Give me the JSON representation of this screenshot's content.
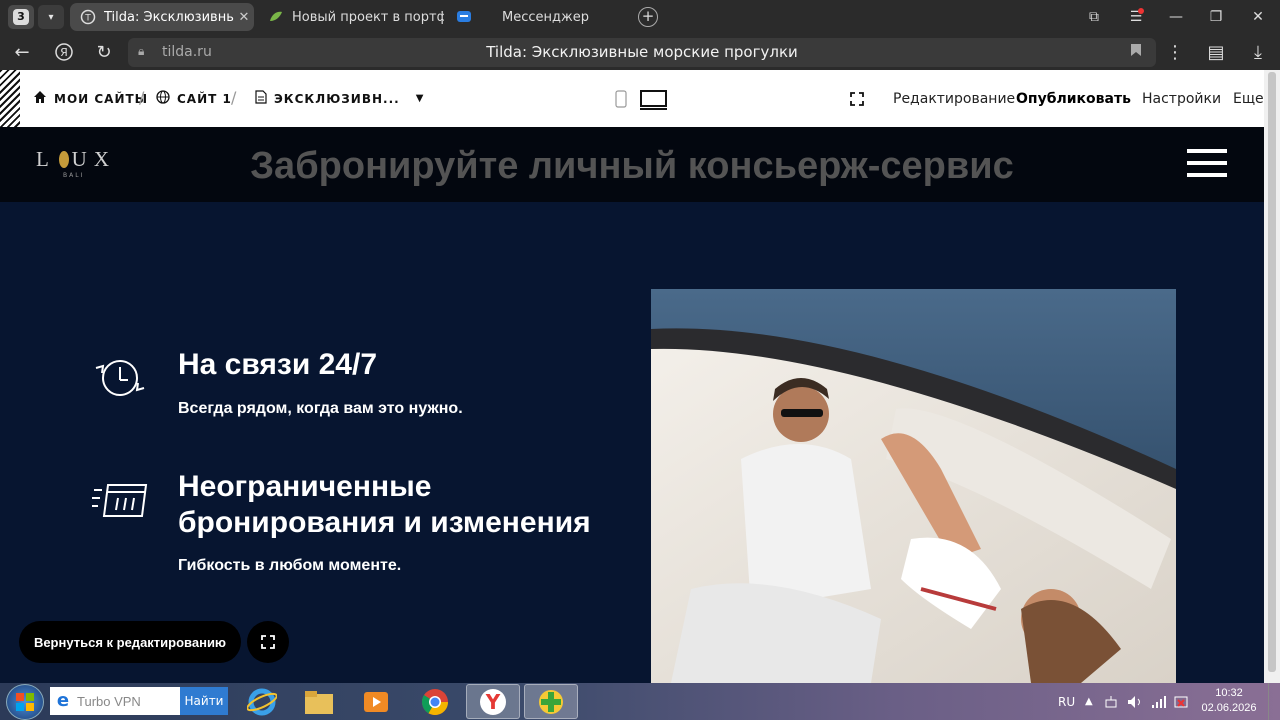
{
  "browser": {
    "tab_count": "3",
    "tabs": [
      {
        "label": "Tilda: Эксклюзивные м",
        "active": true
      },
      {
        "label": "Новый проект в портфол",
        "active": false
      },
      {
        "label": "Мессенджер",
        "active": false
      }
    ],
    "url_host": "tilda.ru",
    "page_title": "Tilda: Эксклюзивные морские прогулки"
  },
  "tilda_panel": {
    "my_sites": "МОИ САЙТЫ",
    "site": "САЙТ 1",
    "page": "ЭКСКЛЮЗИВН...",
    "edit": "Редактирование",
    "publish": "Опубликовать",
    "settings": "Настройки",
    "more": "Еще"
  },
  "site": {
    "logo_word": "LOUX",
    "logo_sub": "BALI",
    "header_title": "Забронируйте личный консьерж-сервис",
    "features": [
      {
        "title": "На связи 24/7",
        "subtitle": "Всегда рядом, когда вам это нужно.",
        "icon": "clock-cycle-icon"
      },
      {
        "title_line1": "Неограниченные",
        "title_line2": "бронирования и изменения",
        "subtitle": "Гибкость в любом моменте.",
        "icon": "calendar-fast-icon"
      }
    ],
    "back_button": "Вернуться к редактированию"
  },
  "taskbar": {
    "search_value": "Turbo VPN",
    "search_button": "Найти",
    "lang": "RU",
    "time": "10:32",
    "date": "02.06.2026"
  }
}
